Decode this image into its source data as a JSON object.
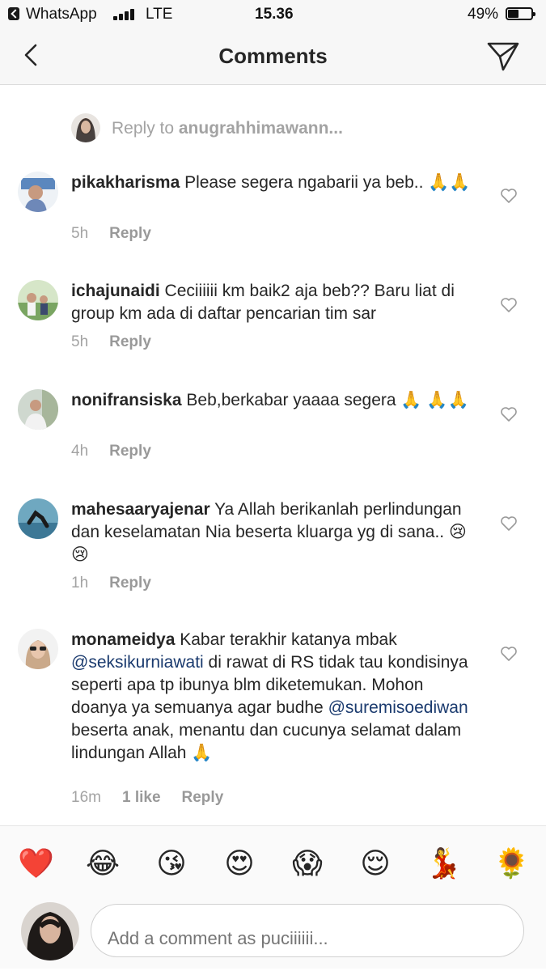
{
  "status_bar": {
    "back_app": "WhatsApp",
    "network": "LTE",
    "time": "15.36",
    "battery": "49%"
  },
  "nav": {
    "title": "Comments",
    "back_icon": "chevron-left-icon",
    "send_icon": "paper-plane-icon"
  },
  "reply_to": {
    "prefix": "Reply to ",
    "user": "anugrahhimawann..."
  },
  "comments": [
    {
      "user": "pikakharisma",
      "text": " Please segera ngabarii ya beb.. 🙏🙏",
      "time": "5h",
      "reply": "Reply",
      "likes": ""
    },
    {
      "user": "ichajunaidi",
      "text": " Ceciiiiii km baik2 aja beb?? Baru liat di group km ada di daftar pencarian tim sar",
      "time": "5h",
      "reply": "Reply",
      "likes": ""
    },
    {
      "user": "nonifransiska",
      "text": " Beb,berkabar yaaaa segera 🙏 🙏🙏",
      "time": "4h",
      "reply": "Reply",
      "likes": ""
    },
    {
      "user": "mahesaaryajenar",
      "text": " Ya Allah berikanlah perlindungan dan keselamatan Nia beserta kluarga yg di sana.. 😢😢",
      "time": "1h",
      "reply": "Reply",
      "likes": ""
    },
    {
      "user": "monameidya",
      "text_1": " Kabar terakhir katanya mbak ",
      "mention_1": "@seksikurniawati",
      "text_2": " di rawat di RS tidak tau kondisinya seperti apa tp ibunya blm diketemukan. Mohon doanya ya semuanya agar budhe ",
      "mention_2": "@suremisoediwan",
      "text_3": " beserta anak, menantu dan cucunya selamat dalam lindungan Allah 🙏",
      "time": "16m",
      "likes": "1 like",
      "reply": "Reply"
    }
  ],
  "emoji_bar": [
    "❤️",
    "😂",
    "😘",
    "😍",
    "😱",
    "😌",
    "💃",
    "🌻"
  ],
  "comment_input": {
    "placeholder": "Add a comment as puciiiiii..."
  },
  "colors": {
    "mention": "#1a3a6e",
    "muted": "#a3a3a3",
    "bar_bg": "#f7f7f7"
  }
}
